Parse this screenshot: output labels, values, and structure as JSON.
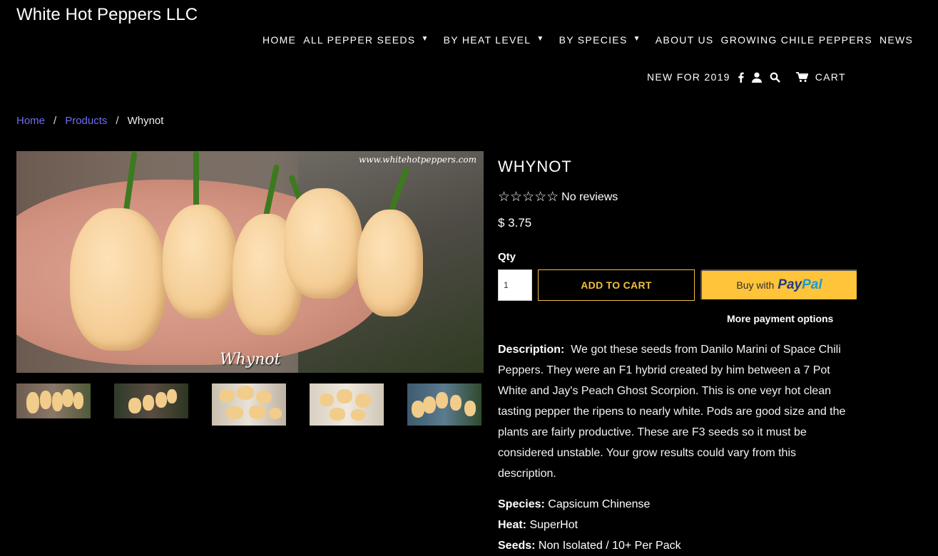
{
  "header": {
    "logo": "White Hot Peppers LLC",
    "nav_row1": [
      {
        "label": "HOME",
        "dropdown": false
      },
      {
        "label": "ALL PEPPER SEEDS",
        "dropdown": true
      },
      {
        "label": "BY HEAT LEVEL",
        "dropdown": true
      },
      {
        "label": "BY SPECIES",
        "dropdown": true
      },
      {
        "label": "ABOUT US",
        "dropdown": false
      },
      {
        "label": "GROWING CHILE PEPPERS",
        "dropdown": false
      },
      {
        "label": "NEWS",
        "dropdown": false
      }
    ],
    "nav_row2": {
      "new_label": "NEW FOR 2019",
      "cart_label": "CART",
      "icons": [
        "facebook-icon",
        "user-icon",
        "search-icon",
        "cart-icon"
      ]
    }
  },
  "breadcrumb": {
    "home": "Home",
    "products": "Products",
    "current": "Whynot",
    "sep": "/"
  },
  "gallery": {
    "watermark": "www.whitehotpeppers.com",
    "caption": "Whynot",
    "thumb_count": 5
  },
  "product": {
    "title": "WHYNOT",
    "stars": "☆☆☆☆☆",
    "reviews": "No reviews",
    "price": "$ 3.75",
    "qty_label": "Qty",
    "qty_value": "1",
    "add_to_cart": "ADD TO CART",
    "paypal_prefix": "Buy with",
    "paypal_brand_a": "Pay",
    "paypal_brand_b": "Pal",
    "more_payment": "More payment options",
    "description_label": "Description:",
    "description_text": "We got these seeds from Danilo Marini of Space Chili Peppers.  They were an F1 hybrid created by him between a 7 Pot White and Jay's Peach Ghost Scorpion.  This is one veyr hot clean tasting pepper the ripens to nearly white. Pods are good size and the plants are fairly productive.  These are F3 seeds so it must be considered unstable. Your grow results could vary from this description.",
    "specs": [
      {
        "label": "Species:",
        "value": "Capsicum Chinense"
      },
      {
        "label": "Heat:",
        "value": "SuperHot"
      },
      {
        "label": "Seeds:",
        "value": "Non Isolated / 10+ Per Pack"
      }
    ]
  },
  "colors": {
    "background": "#000000",
    "link": "#6f6cf5",
    "accent_gold": "#f0c040",
    "paypal_yellow": "#ffc439"
  }
}
